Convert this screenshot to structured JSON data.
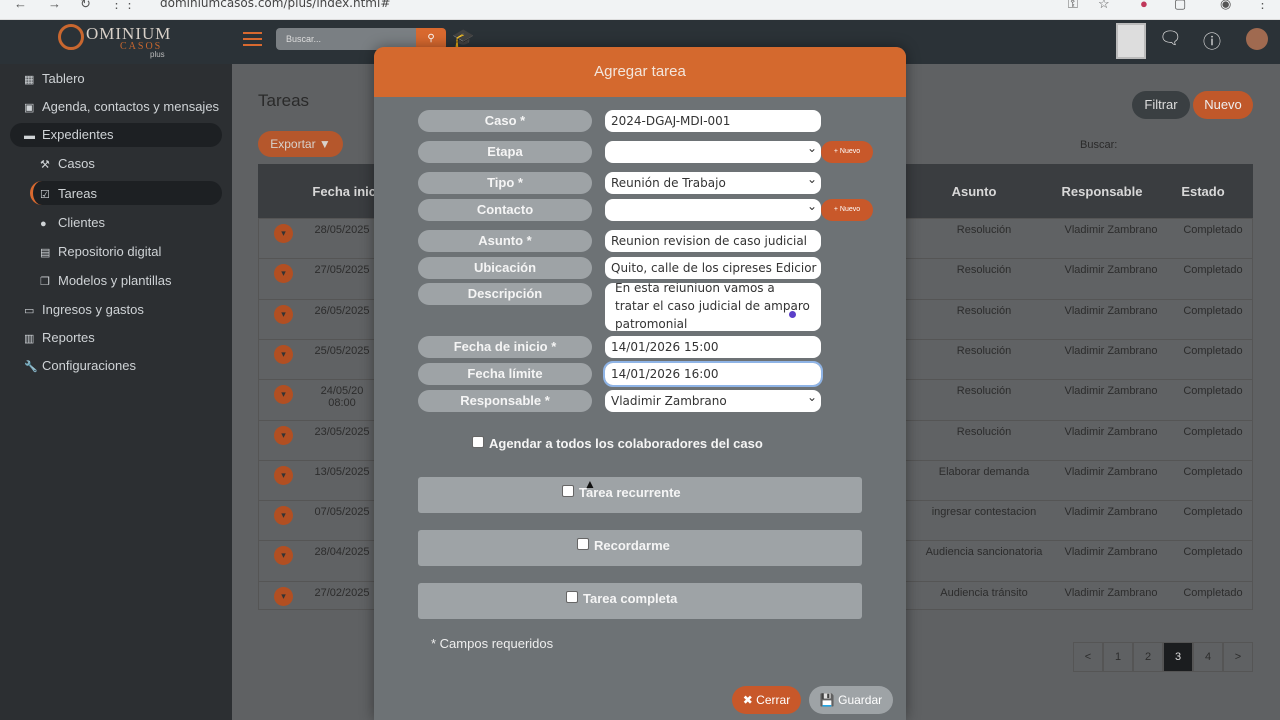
{
  "browser": {
    "url": "dominiumcasos.com/plus/index.html#"
  },
  "logo": {
    "text1": "OMINIUM",
    "text2": "CASOS",
    "text3": "plus"
  },
  "topbar": {
    "search_placeholder": "Buscar..."
  },
  "sidebar": {
    "items": [
      {
        "label": "Tablero",
        "icon": "table-icon"
      },
      {
        "label": "Agenda, contactos y mensajes",
        "icon": "contact-icon"
      },
      {
        "label": "Expedientes",
        "icon": "folder-icon"
      },
      {
        "label": "Casos",
        "icon": "gavel-icon"
      },
      {
        "label": "Tareas",
        "icon": "checkbox-icon"
      },
      {
        "label": "Clientes",
        "icon": "user-icon"
      },
      {
        "label": "Repositorio digital",
        "icon": "book-icon"
      },
      {
        "label": "Modelos y plantillas",
        "icon": "copy-icon"
      },
      {
        "label": "Ingresos y gastos",
        "icon": "money-icon"
      },
      {
        "label": "Reportes",
        "icon": "chart-icon"
      },
      {
        "label": "Configuraciones",
        "icon": "wrench-icon"
      }
    ]
  },
  "main": {
    "title": "Tareas",
    "filter_label": "Filtrar",
    "new_label": "Nuevo",
    "export_label": "Exportar ▼",
    "search_label": "Buscar:"
  },
  "table": {
    "headers": [
      "Fecha inicio",
      "Asunto",
      "Responsable",
      "Estado"
    ],
    "rows": [
      {
        "date": "28/05/2025",
        "asunto": "Resolución",
        "resp": "Vladimir Zambrano",
        "estado": "Completado"
      },
      {
        "date": "27/05/2025",
        "asunto": "Resolución",
        "resp": "Vladimir Zambrano",
        "estado": "Completado"
      },
      {
        "date": "26/05/2025",
        "asunto": "Resolución",
        "resp": "Vladimir Zambrano",
        "estado": "Completado"
      },
      {
        "date": "25/05/2025",
        "asunto": "Resolución",
        "resp": "Vladimir Zambrano",
        "estado": "Completado"
      },
      {
        "date": "24/05/20 08:00",
        "asunto": "Resolución",
        "resp": "Vladimir Zambrano",
        "estado": "Completado"
      },
      {
        "date": "23/05/2025",
        "asunto": "Resolución",
        "resp": "Vladimir Zambrano",
        "estado": "Completado"
      },
      {
        "date": "13/05/2025",
        "asunto": "Elaborar demanda",
        "resp": "Vladimir Zambrano",
        "estado": "Completado"
      },
      {
        "date": "07/05/2025",
        "asunto": "ingresar contestacion",
        "resp": "Vladimir Zambrano",
        "estado": "Completado"
      },
      {
        "date": "28/04/2025",
        "asunto": "Audiencia sancionatoria",
        "resp": "Vladimir Zambrano",
        "estado": "Completado"
      },
      {
        "date": "27/02/2025",
        "asunto": "Audiencia tránsito",
        "resp": "Vladimir Zambrano",
        "estado": "Completado"
      }
    ]
  },
  "pagination": {
    "prev": "<",
    "pages": [
      "1",
      "2",
      "3",
      "4"
    ],
    "current": "3",
    "next": ">"
  },
  "modal": {
    "title": "Agregar tarea",
    "fields": {
      "caso": {
        "label": "Caso *",
        "value": "2024-DGAJ-MDI-001"
      },
      "etapa": {
        "label": "Etapa",
        "value": ""
      },
      "tipo": {
        "label": "Tipo *",
        "value": "Reunión de Trabajo"
      },
      "contacto": {
        "label": "Contacto",
        "value": ""
      },
      "asunto": {
        "label": "Asunto *",
        "value": "Reunion revision de caso judicial"
      },
      "ubicacion": {
        "label": "Ubicación",
        "value": "Quito, calle de los cipreses Edicior"
      },
      "descripcion": {
        "label": "Descripción",
        "value": "En esta reiuniuon vamos a tratar el caso judicial de amparo patromonial"
      },
      "fecha_inicio": {
        "label": "Fecha de inicio *",
        "value": "14/01/2026 15:00"
      },
      "fecha_limite": {
        "label": "Fecha límite",
        "value": "14/01/2026 16:00"
      },
      "responsable": {
        "label": "Responsable *",
        "value": "Vladimir Zambrano"
      }
    },
    "nuevo_label": "+ Nuevo",
    "agendar_label": "Agendar a todos los colaboradores del caso",
    "recurrente_label": "Tarea recurrente",
    "recordarme_label": "Recordarme",
    "completa_label": "Tarea completa",
    "required_note": "* Campos requeridos",
    "close_label": "✖ Cerrar",
    "save_label": "💾 Guardar"
  }
}
